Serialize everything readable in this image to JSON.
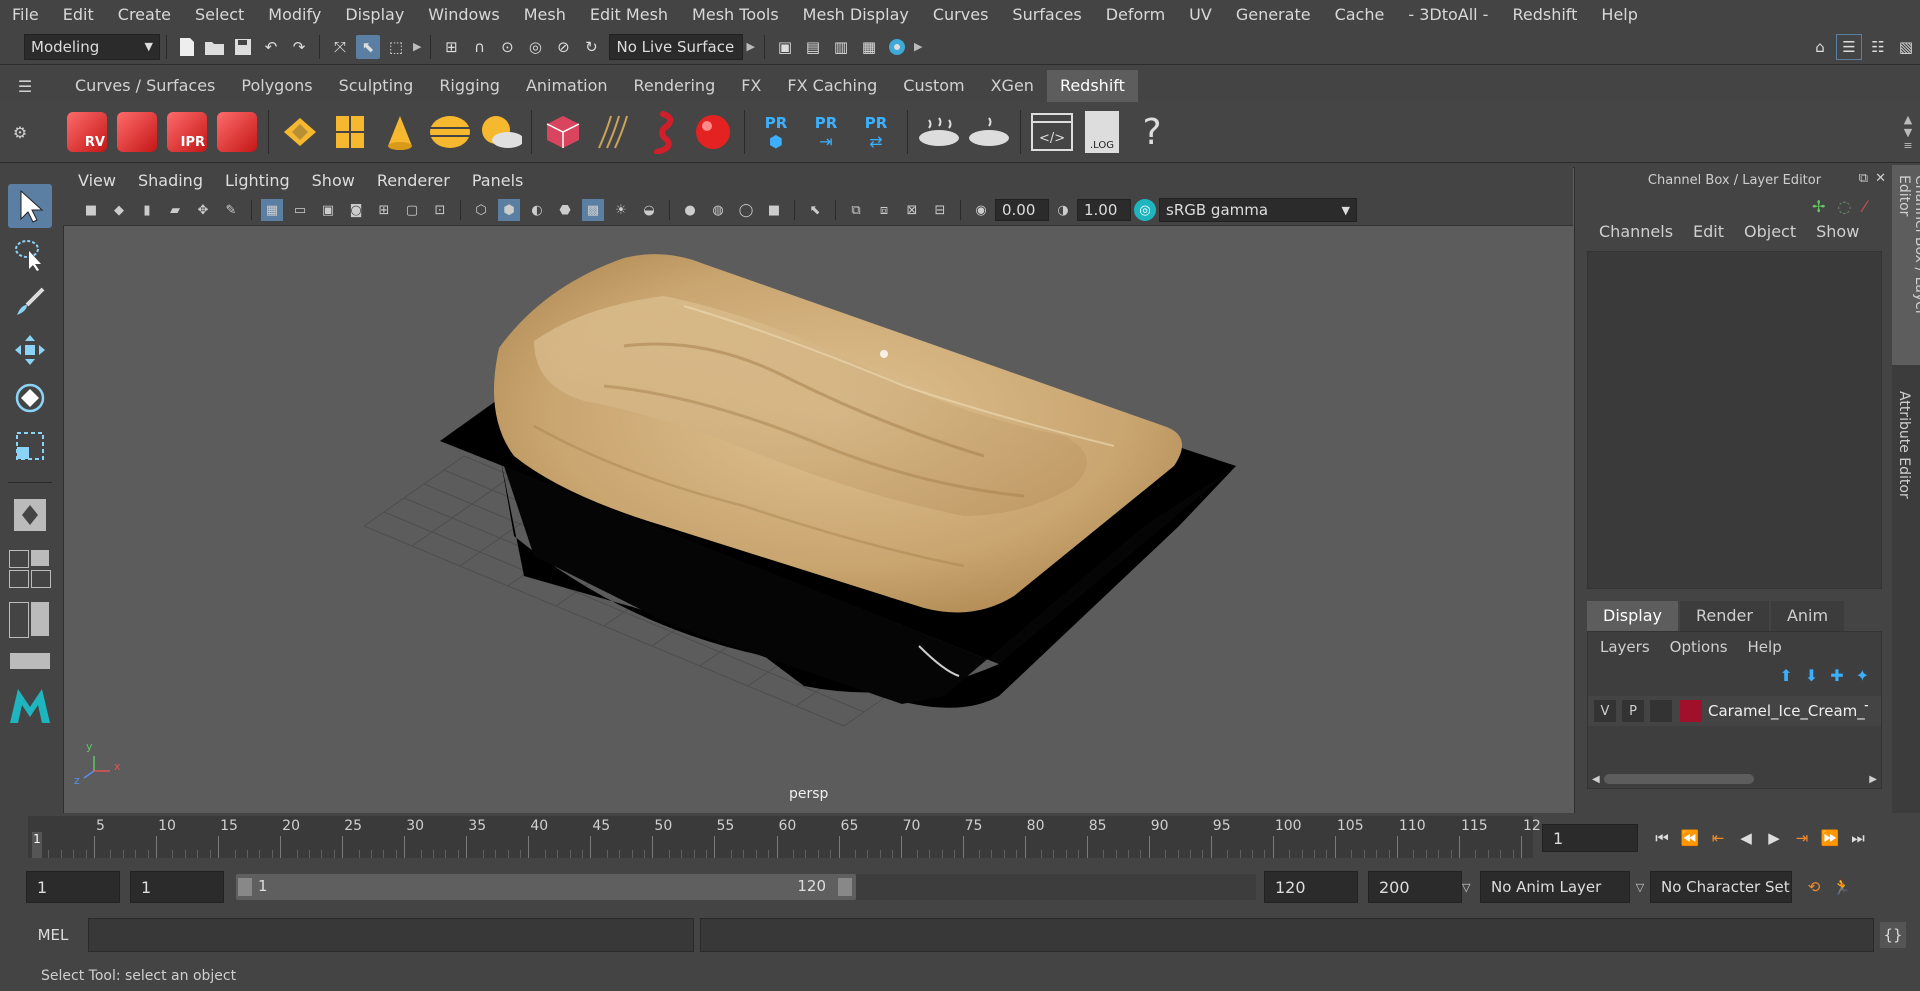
{
  "menubar": [
    "File",
    "Edit",
    "Create",
    "Select",
    "Modify",
    "Display",
    "Windows",
    "Mesh",
    "Edit Mesh",
    "Mesh Tools",
    "Mesh Display",
    "Curves",
    "Surfaces",
    "Deform",
    "UV",
    "Generate",
    "Cache",
    "- 3DtoAll -",
    "Redshift",
    "Help"
  ],
  "statusline": {
    "mode": "Modeling",
    "live_surface": "No Live Surface"
  },
  "shelf_tabs": [
    "Curves / Surfaces",
    "Polygons",
    "Sculpting",
    "Rigging",
    "Animation",
    "Rendering",
    "FX",
    "FX Caching",
    "Custom",
    "XGen",
    "Redshift"
  ],
  "shelf_active": "Redshift",
  "shelf_labels": {
    "rv": "RV",
    "ipr": "IPR",
    "pr": "PR",
    "log": ".LOG",
    "help": "?"
  },
  "viewport": {
    "menus": [
      "View",
      "Shading",
      "Lighting",
      "Show",
      "Renderer",
      "Panels"
    ],
    "exposure": "0.00",
    "gamma": "1.00",
    "colorspace": "sRGB gamma",
    "camera_label": "persp",
    "axis_x": "x",
    "axis_y": "y",
    "axis_z": "z"
  },
  "channel_box": {
    "title": "Channel Box / Layer Editor",
    "menus": [
      "Channels",
      "Edit",
      "Object",
      "Show"
    ]
  },
  "layer_editor": {
    "tabs": [
      "Display",
      "Render",
      "Anim"
    ],
    "active_tab": "Display",
    "menus": [
      "Layers",
      "Options",
      "Help"
    ],
    "layer": {
      "v": "V",
      "p": "P",
      "name": "Caramel_Ice_Cream_Tra",
      "color": "#a0102a"
    }
  },
  "side_tabs": [
    "Channel Box / Layer Editor",
    "Attribute Editor"
  ],
  "timeline": {
    "ticks": [
      "5",
      "10",
      "15",
      "20",
      "25",
      "30",
      "35",
      "40",
      "45",
      "50",
      "55",
      "60",
      "65",
      "70",
      "75",
      "80",
      "85",
      "90",
      "95",
      "100",
      "105",
      "110",
      "115",
      "12"
    ],
    "current_frame_marker": "1",
    "current_frame": "1"
  },
  "range": {
    "start": "1",
    "playback_start": "1",
    "slider_start": "1",
    "slider_end": "120",
    "playback_end": "120",
    "end": "200",
    "anim_layer": "No Anim Layer",
    "character_set": "No Character Set"
  },
  "command_line": {
    "lang": "MEL"
  },
  "help_line": "Select Tool: select an object",
  "colors": {
    "accent": "#5a7fa3",
    "ice_cream": "#d2b07e",
    "tray": "#000000",
    "layer_color": "#a0102a"
  }
}
